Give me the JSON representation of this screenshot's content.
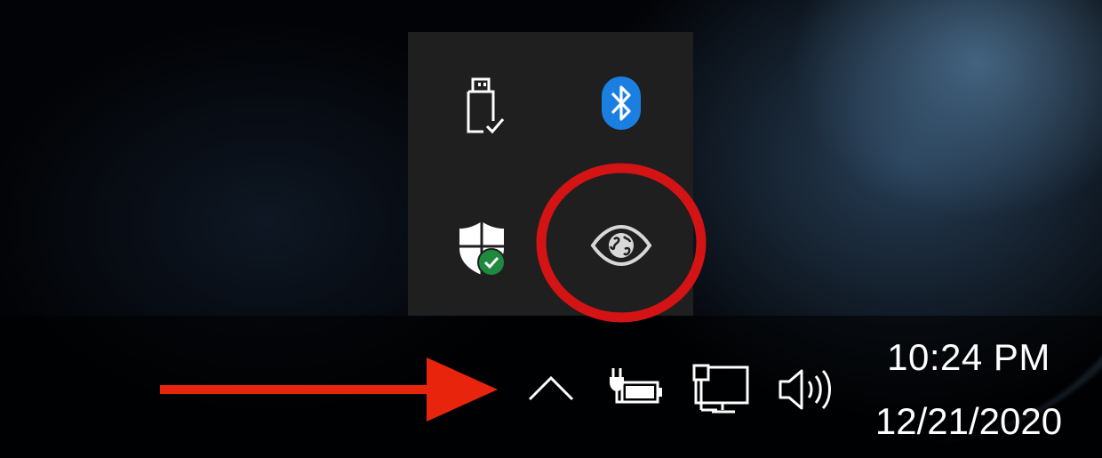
{
  "desktop": {
    "wallpaper": "earth-from-space"
  },
  "tray_flyout": {
    "icons": [
      {
        "name": "usb-safely-remove-icon"
      },
      {
        "name": "bluetooth-icon",
        "color": "#1a7fe0"
      },
      {
        "name": "windows-security-icon",
        "badge_color": "#1f8a3f"
      },
      {
        "name": "eye-globe-icon"
      }
    ]
  },
  "taskbar": {
    "tray_icons": [
      {
        "name": "show-hidden-icons-chevron"
      },
      {
        "name": "battery-charging-icon"
      },
      {
        "name": "network-wired-icon"
      },
      {
        "name": "volume-icon"
      }
    ],
    "clock": {
      "time": "10:24 PM",
      "date": "12/21/2020"
    }
  },
  "annotations": {
    "arrow_color": "#e8250c",
    "circle_color": "#d41414"
  }
}
